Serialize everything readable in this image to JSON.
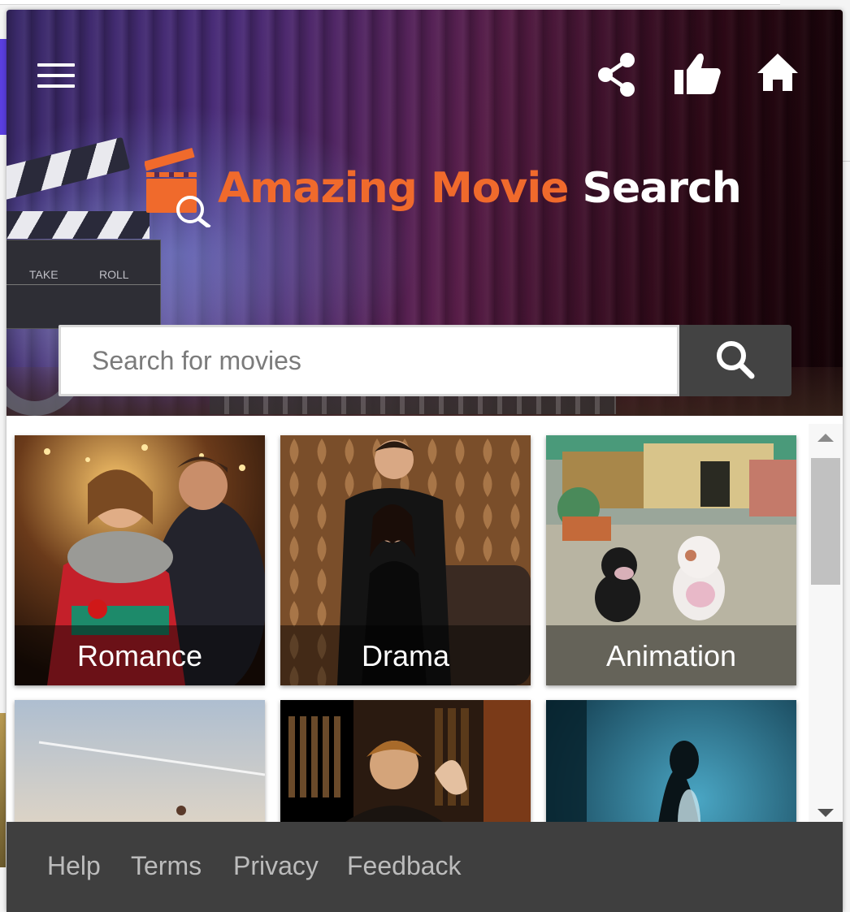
{
  "header": {
    "menu_icon": "hamburger-menu-icon",
    "actions": [
      {
        "icon": "share-icon"
      },
      {
        "icon": "thumbs-up-icon"
      },
      {
        "icon": "home-icon"
      }
    ],
    "logo": {
      "word1": "Amazing Movie",
      "word2": "Search",
      "accent_color": "#f06a2c",
      "icon": "clapperboard-magnifier-icon"
    },
    "clapper": {
      "take": "TAKE",
      "roll": "ROLL"
    }
  },
  "search": {
    "placeholder": "Search for movies",
    "value": "",
    "button_icon": "search-icon"
  },
  "categories": [
    {
      "label": "Romance"
    },
    {
      "label": "Drama"
    },
    {
      "label": "Animation"
    },
    {
      "label": ""
    },
    {
      "label": ""
    },
    {
      "label": ""
    }
  ],
  "footer": {
    "links": [
      "Help",
      "Terms",
      "Privacy",
      "Feedback"
    ],
    "background": "#3f3f3f"
  }
}
